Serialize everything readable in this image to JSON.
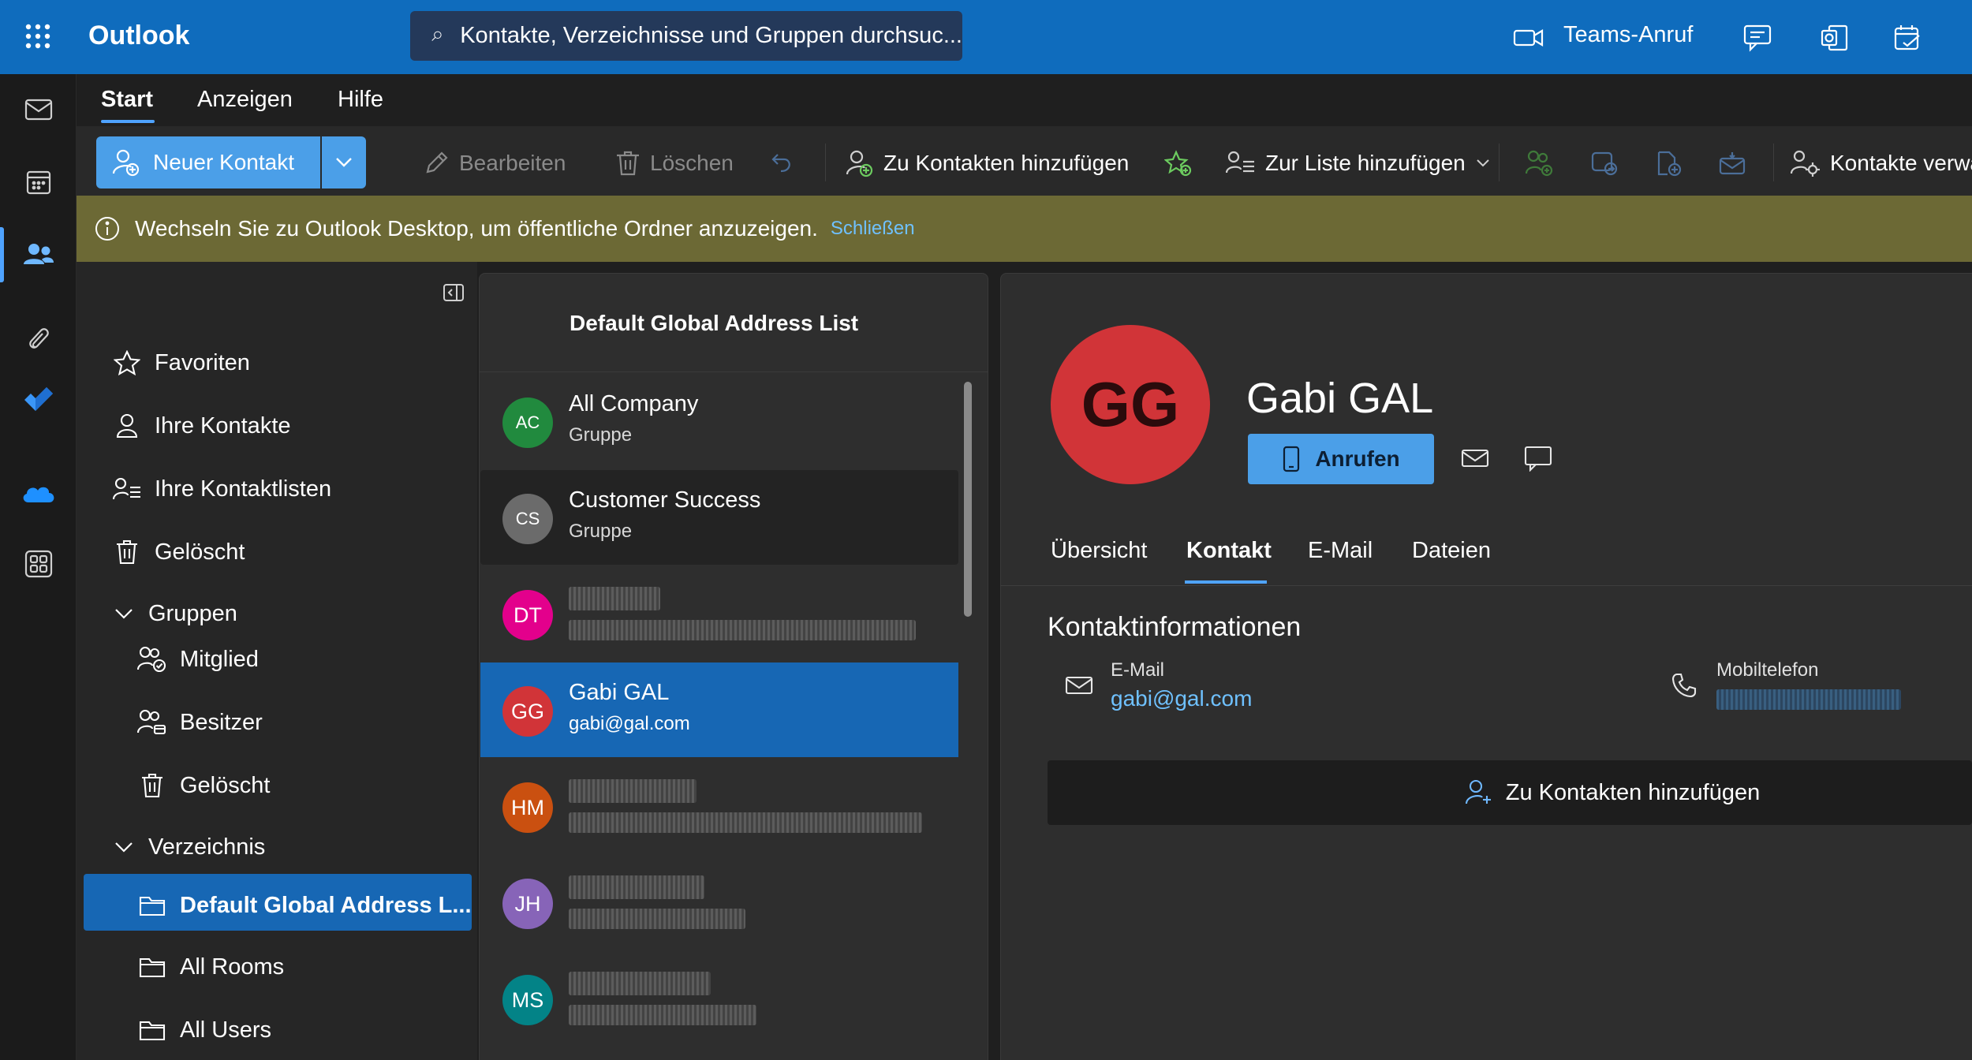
{
  "app": {
    "title": "Outlook"
  },
  "search": {
    "placeholder": "Kontakte, Verzeichnisse und Gruppen durchsuc..."
  },
  "topbar": {
    "teams_call": "Teams-Anruf"
  },
  "ribbon": {
    "tabs": [
      {
        "label": "Start"
      },
      {
        "label": "Anzeigen"
      },
      {
        "label": "Hilfe"
      }
    ],
    "active_tab": "Start",
    "new_contact": "Neuer Kontakt",
    "edit": "Bearbeiten",
    "delete": "Löschen",
    "add_to_contacts": "Zu Kontakten hinzufügen",
    "add_to_list": "Zur Liste hinzufügen",
    "manage_contacts": "Kontakte verwa"
  },
  "infobar": {
    "message": "Wechseln Sie zu Outlook Desktop, um öffentliche Ordner anzuzeigen.",
    "close": "Schließen"
  },
  "nav": {
    "favorites": "Favoriten",
    "your_contacts": "Ihre Kontakte",
    "your_lists": "Ihre Kontaktlisten",
    "deleted": "Gelöscht",
    "groups": "Gruppen",
    "member": "Mitglied",
    "owner": "Besitzer",
    "groups_deleted": "Gelöscht",
    "directory": "Verzeichnis",
    "gal": "Default Global Address L...",
    "rooms": "All Rooms",
    "users": "All Users"
  },
  "list": {
    "title": "Default Global Address List",
    "rows": [
      {
        "initials": "AC",
        "name": "All Company",
        "sub": "Gruppe",
        "color": "#218a3e"
      },
      {
        "initials": "CS",
        "name": "Customer Success",
        "sub": "Gruppe",
        "color": "#6b6b6b"
      },
      {
        "initials": "DT",
        "name": "",
        "sub": "",
        "color": "#e3008c"
      },
      {
        "initials": "GG",
        "name": "Gabi GAL",
        "sub": "gabi@gal.com",
        "color": "#d13438"
      },
      {
        "initials": "HM",
        "name": "",
        "sub": "",
        "color": "#ca5010"
      },
      {
        "initials": "JH",
        "name": "",
        "sub": "",
        "color": "#8764b8"
      },
      {
        "initials": "MS",
        "name": "",
        "sub": "",
        "color": "#038387"
      }
    ]
  },
  "detail": {
    "initials": "GG",
    "name": "Gabi GAL",
    "call": "Anrufen",
    "tabs": [
      {
        "label": "Übersicht"
      },
      {
        "label": "Kontakt"
      },
      {
        "label": "E-Mail"
      },
      {
        "label": "Dateien"
      }
    ],
    "active_tab": "Kontakt",
    "section_title": "Kontaktinformationen",
    "email_label": "E-Mail",
    "email": "gabi@gal.com",
    "mobile_label": "Mobiltelefon",
    "add_to_contacts": "Zu Kontakten hinzufügen"
  },
  "colors": {
    "accent": "#0f6cbd",
    "selected": "#1767b4",
    "button": "#4b9fe8",
    "avatar": "#d13438"
  }
}
